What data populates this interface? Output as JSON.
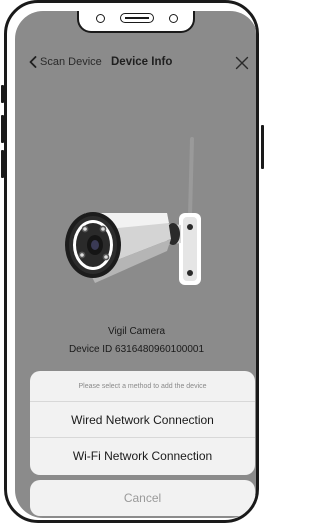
{
  "nav": {
    "back_label": "Scan Device",
    "title": "Device Info"
  },
  "device": {
    "name": "Vigil Camera",
    "id_text": "Device ID 6316480960100001"
  },
  "action_sheet": {
    "prompt": "Please select a method to add the device",
    "options": [
      {
        "label": "Wired Network Connection"
      },
      {
        "label": "Wi-Fi Network Connection"
      }
    ],
    "cancel_label": "Cancel"
  },
  "icons": {
    "back": "chevron-left-icon",
    "close": "close-icon"
  },
  "colors": {
    "overlay_background": "#8b8b8b",
    "sheet_background": "#f2f2f2",
    "cancel_text": "#9a9a9a"
  }
}
